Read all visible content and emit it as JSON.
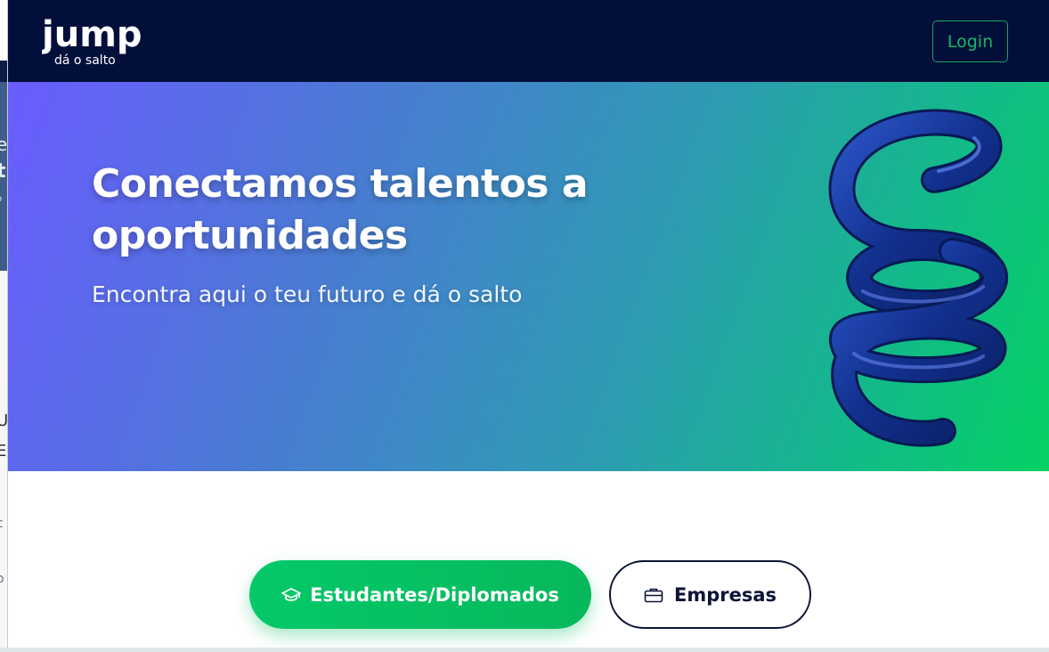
{
  "bg_window": {
    "fragments": [
      "e",
      "t",
      "o",
      "U",
      "E",
      "l",
      "c",
      "i",
      "o"
    ]
  },
  "header": {
    "logo": {
      "wordmark": "jump",
      "tagline": "dá o salto"
    },
    "login_label": "Login"
  },
  "hero": {
    "title": "Conectamos talentos a oportunidades",
    "subtitle": "Encontra aqui o teu futuro e dá o salto",
    "illustration": "blue-spring-icon"
  },
  "cta": {
    "students": {
      "label": "Estudantes/Diplomados",
      "icon": "graduation-cap-icon"
    },
    "companies": {
      "label": "Empresas",
      "icon": "briefcase-icon"
    }
  },
  "colors": {
    "navbar": "#020f3a",
    "accent_green": "#04c969",
    "navy": "#0b1435",
    "hero_gradient_start": "#6a5cff",
    "hero_gradient_end": "#04d163"
  }
}
